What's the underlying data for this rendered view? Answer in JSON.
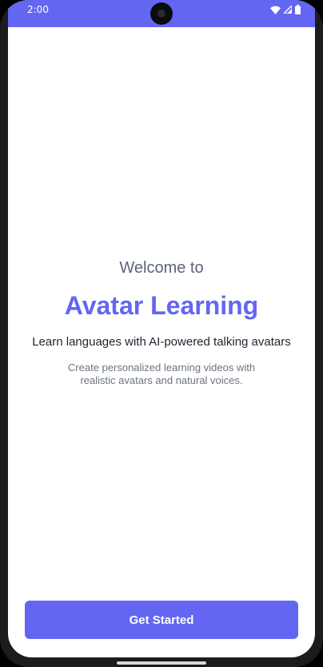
{
  "status_bar": {
    "time": "2:00",
    "background_color": "#6366f1",
    "icons": [
      "wifi-icon",
      "signal-icon",
      "battery-icon"
    ]
  },
  "welcome_screen": {
    "welcome_text": "Welcome to",
    "app_title": "Avatar Learning",
    "tagline": "Learn languages with AI-powered talking avatars",
    "description": "Create personalized learning videos with realistic avatars and natural voices.",
    "get_started_label": "Get Started"
  },
  "colors": {
    "accent": "#6366f1",
    "text_primary": "#1f2430",
    "text_secondary": "#6b7280"
  }
}
